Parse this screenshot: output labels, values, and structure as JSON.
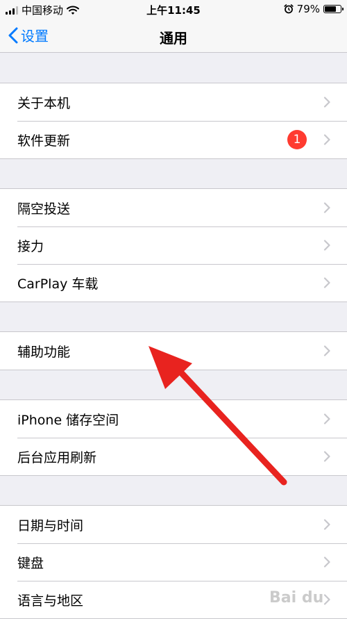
{
  "status_bar": {
    "carrier": "中国移动",
    "time": "上午11:45",
    "battery_percent": "79%",
    "battery_level": 0.79,
    "icons": [
      "signal-icon",
      "wifi-icon",
      "alarm-icon",
      "battery-icon"
    ]
  },
  "nav": {
    "back_label": "设置",
    "title": "通用"
  },
  "groups": [
    {
      "items": [
        {
          "label": "关于本机"
        },
        {
          "label": "软件更新",
          "badge": "1"
        }
      ]
    },
    {
      "items": [
        {
          "label": "隔空投送"
        },
        {
          "label": "接力"
        },
        {
          "label": "CarPlay 车载"
        }
      ]
    },
    {
      "items": [
        {
          "label": "辅助功能"
        }
      ]
    },
    {
      "items": [
        {
          "label": "iPhone 储存空间"
        },
        {
          "label": "后台应用刷新"
        }
      ]
    },
    {
      "items": [
        {
          "label": "日期与时间"
        },
        {
          "label": "键盘"
        },
        {
          "label": "语言与地区"
        }
      ]
    }
  ],
  "colors": {
    "accent": "#007aff",
    "badge": "#ff3b30",
    "annotation_arrow": "#e8231f",
    "background": "#efeff4"
  },
  "watermark": "Bai du"
}
